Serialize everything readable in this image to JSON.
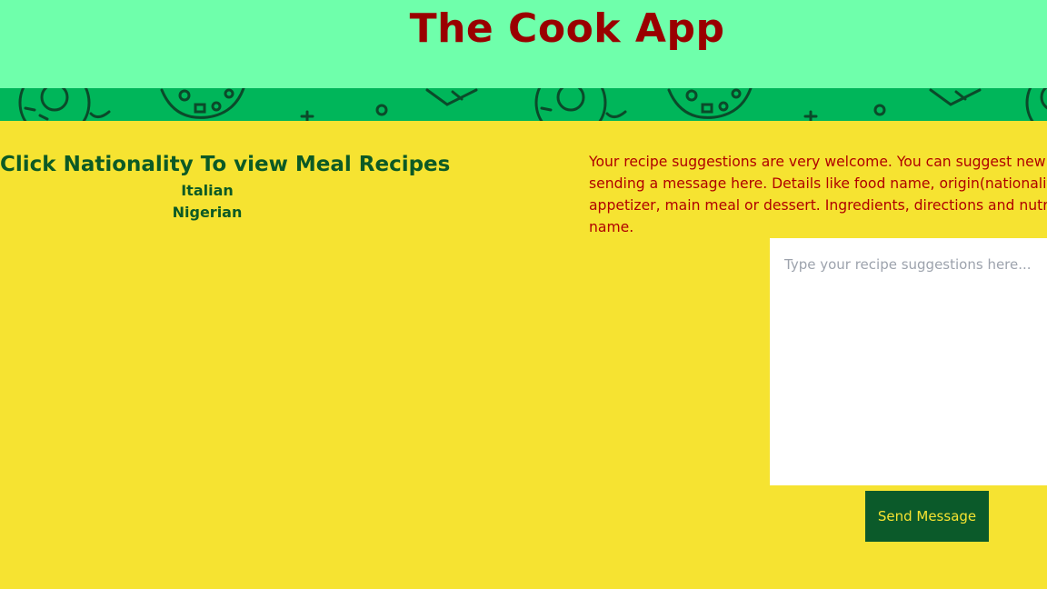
{
  "header": {
    "title": "The Cook App"
  },
  "colors": {
    "header_bg": "#6fffab",
    "title": "#9a0000",
    "banner_bg": "#00b65a",
    "page_bg": "#f6e331",
    "heading": "#0c5a25",
    "message_text": "#b00000",
    "button_bg": "#0b5a2a",
    "button_text": "#f6e331"
  },
  "banner": {
    "pattern": "food-doodle-pattern"
  },
  "nationalities": {
    "heading": "Click Nationality To view Meal Recipes",
    "items": [
      {
        "label": "Italian"
      },
      {
        "label": "Nigerian"
      }
    ]
  },
  "suggestions": {
    "intro_lines": [
      "Your recipe suggestions are very welcome. You can suggest new recipe",
      "sending a message here. Details like food name, origin(nationality), wh",
      "appetizer, main meal or dessert. Ingredients, directions and nutritiona",
      "name."
    ],
    "placeholder": "Type your recipe suggestions here...",
    "value": "",
    "send_label": "Send Message"
  }
}
